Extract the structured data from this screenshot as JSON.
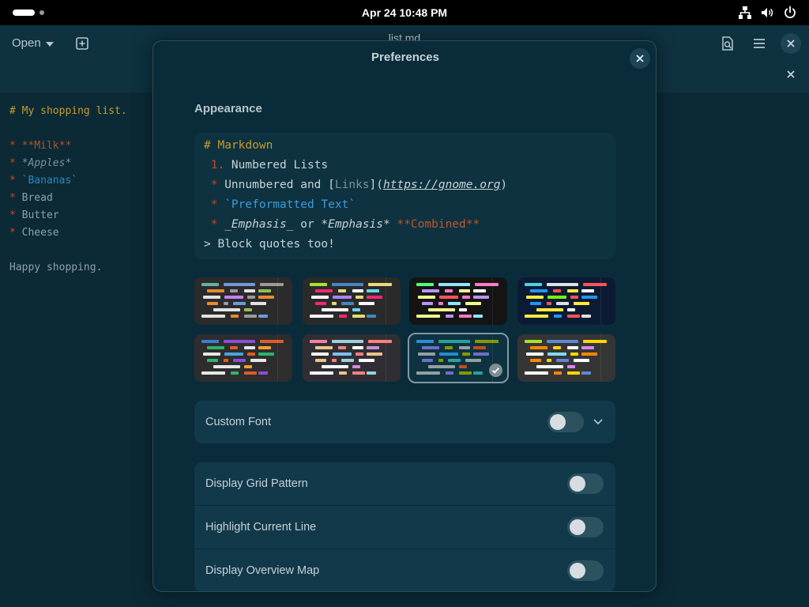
{
  "topbar": {
    "clock": "Apr 24  10:48 PM"
  },
  "headerbar": {
    "open_label": "Open",
    "doc_title": "list.md"
  },
  "editor": {
    "lines": [
      [
        {
          "t": "# My shopping list.",
          "c": "c-head"
        }
      ],
      [],
      [
        {
          "t": "* ",
          "c": "c-star"
        },
        {
          "t": "**Milk**",
          "c": "c-bold"
        }
      ],
      [
        {
          "t": "* ",
          "c": "c-star"
        },
        {
          "t": "*Apples*",
          "c": "c-ital"
        }
      ],
      [
        {
          "t": "* ",
          "c": "c-star"
        },
        {
          "t": "`Bananas`",
          "c": "c-code"
        }
      ],
      [
        {
          "t": "* ",
          "c": "c-star"
        },
        {
          "t": "Bread",
          "c": "c-plain"
        }
      ],
      [
        {
          "t": "* ",
          "c": "c-star"
        },
        {
          "t": "Butter",
          "c": "c-plain"
        }
      ],
      [
        {
          "t": "* ",
          "c": "c-star"
        },
        {
          "t": "Cheese",
          "c": "c-plain"
        }
      ],
      [],
      [
        {
          "t": "Happy shopping.",
          "c": "c-plain"
        }
      ]
    ]
  },
  "dialog": {
    "title": "Preferences",
    "appearance_label": "Appearance",
    "preview_lines": [
      [
        {
          "t": "# Markdown",
          "c": "p-head"
        }
      ],
      [
        {
          "t": " 1.",
          "c": "p-num"
        },
        {
          "t": " Numbered Lists",
          "c": "p-plain"
        }
      ],
      [
        {
          "t": " *",
          "c": "p-star"
        },
        {
          "t": " Unnumbered and ",
          "c": "p-plain"
        },
        {
          "t": "[",
          "c": "p-plain"
        },
        {
          "t": "Links",
          "c": "p-dim"
        },
        {
          "t": "](",
          "c": "p-plain"
        },
        {
          "t": "https://gnome.org",
          "c": "p-link"
        },
        {
          "t": ")",
          "c": "p-plain"
        }
      ],
      [
        {
          "t": " *",
          "c": "p-star"
        },
        {
          "t": " `Preformatted Text`",
          "c": "p-code"
        }
      ],
      [
        {
          "t": " *",
          "c": "p-star"
        },
        {
          "t": " _Emphasis_",
          "c": "p-ital"
        },
        {
          "t": " or ",
          "c": "p-plain"
        },
        {
          "t": "*Emphasis*",
          "c": "p-ital"
        },
        {
          "t": " **Combined**",
          "c": "p-bold"
        }
      ],
      [
        {
          "t": "> Block quotes too!",
          "c": "p-plain"
        }
      ]
    ],
    "schemes": [
      {
        "name": "scheme-1",
        "bg": "#2b2b2b",
        "colors": [
          "#5fb3a1",
          "#6b9bd8",
          "#9a9a9a",
          "#e68a2e",
          "#e2e2e2",
          "#8fbf5a",
          "#c77dff"
        ],
        "selected": false
      },
      {
        "name": "scheme-2",
        "bg": "#2a2a2a",
        "colors": [
          "#a6e22e",
          "#3f88c5",
          "#e6db74",
          "#f92672",
          "#ffffff",
          "#66d9ef",
          "#ae81ff"
        ],
        "selected": false
      },
      {
        "name": "scheme-3",
        "bg": "#141414",
        "colors": [
          "#50fa7b",
          "#8be9fd",
          "#ff79c6",
          "#bd93f9",
          "#f1fa8c",
          "#ffffff",
          "#ff5555"
        ],
        "selected": false
      },
      {
        "name": "scheme-4",
        "bg": "#0c1b33",
        "colors": [
          "#4dd0e1",
          "#e0e0e0",
          "#ff5252",
          "#2196f3",
          "#ffeb3b",
          "#ffffff",
          "#76ff03"
        ],
        "selected": false
      },
      {
        "name": "scheme-5",
        "bg": "#2d2d2d",
        "colors": [
          "#3e7bd6",
          "#8a4fd6",
          "#e05a2b",
          "#2fb36b",
          "#e6e6e6",
          "#f0a030",
          "#4aa3df"
        ],
        "selected": false
      },
      {
        "name": "scheme-6",
        "bg": "#2f2f33",
        "colors": [
          "#f47fa4",
          "#9ad1e0",
          "#ff8080",
          "#f2c28a",
          "#ffffff",
          "#d08ae0",
          "#7ec0ff"
        ],
        "selected": false
      },
      {
        "name": "scheme-7",
        "bg": "#0e3240",
        "colors": [
          "#2a8fd8",
          "#2aa198",
          "#859900",
          "#6c71c4",
          "#93a1a1",
          "#cb4b16",
          "#268bd2"
        ],
        "selected": true
      },
      {
        "name": "scheme-8",
        "bg": "#353535",
        "colors": [
          "#a6e22e",
          "#5f87d7",
          "#ffd700",
          "#ff8700",
          "#ffffff",
          "#d787ff",
          "#87d7ff"
        ],
        "selected": false
      }
    ],
    "custom_font_label": "Custom Font",
    "rows": [
      {
        "label": "Display Grid Pattern",
        "on": false
      },
      {
        "label": "Highlight Current Line",
        "on": false
      },
      {
        "label": "Display Overview Map",
        "on": false
      }
    ],
    "custom_font_on": false
  }
}
